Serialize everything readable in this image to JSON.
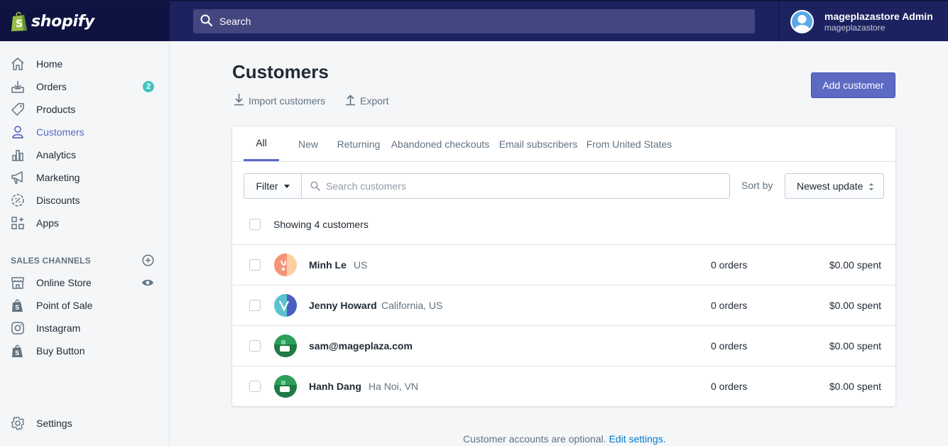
{
  "brand": {
    "logo_text": "shopify",
    "logo_color": "#95bf47"
  },
  "topbar": {
    "search_label": "Search",
    "user_name": "mageplazastore Admin",
    "user_store": "mageplazastore"
  },
  "sidebar": {
    "items": [
      {
        "label": "Home",
        "icon": "home-icon"
      },
      {
        "label": "Orders",
        "icon": "orders-icon",
        "badge": "2"
      },
      {
        "label": "Products",
        "icon": "tag-icon"
      },
      {
        "label": "Customers",
        "icon": "person-icon",
        "active": true
      },
      {
        "label": "Analytics",
        "icon": "bar-chart-icon"
      },
      {
        "label": "Marketing",
        "icon": "megaphone-icon"
      },
      {
        "label": "Discounts",
        "icon": "discount-icon"
      },
      {
        "label": "Apps",
        "icon": "apps-icon"
      }
    ],
    "sales_channels_title": "SALES CHANNELS",
    "channels": [
      {
        "label": "Online Store",
        "icon": "store-icon"
      },
      {
        "label": "Point of Sale",
        "icon": "shopify-bag-icon"
      },
      {
        "label": "Instagram",
        "icon": "instagram-icon"
      },
      {
        "label": "Buy Button",
        "icon": "shopify-bag-icon"
      }
    ],
    "settings_label": "Settings"
  },
  "main": {
    "title": "Customers",
    "import_label": "Import customers",
    "export_label": "Export",
    "add_button": "Add customer",
    "tabs": [
      "All",
      "New",
      "Returning",
      "Abandoned checkouts",
      "Email subscribers",
      "From United States"
    ],
    "filter_label": "Filter",
    "search_placeholder": "Search customers",
    "sort_by_label": "Sort by",
    "sort_value": "Newest update",
    "showing_text": "Showing 4 customers",
    "customers": [
      {
        "name": "Minh Le",
        "location": "US",
        "orders": "0 orders",
        "spent": "$0.00 spent",
        "avatar": "coral"
      },
      {
        "name": "Jenny Howard",
        "location": "California, US",
        "orders": "0 orders",
        "spent": "$0.00 spent",
        "avatar": "teal"
      },
      {
        "name": "sam@mageplaza.com",
        "location": "",
        "orders": "0 orders",
        "spent": "$0.00 spent",
        "avatar": "green"
      },
      {
        "name": "Hanh Dang",
        "location": "Ha Noi, VN",
        "orders": "0 orders",
        "spent": "$0.00 spent",
        "avatar": "green"
      }
    ],
    "footer_text": "Customer accounts are optional.",
    "footer_link": "Edit settings."
  },
  "colors": {
    "accent": "#5c6ac4",
    "topbar": "#1c2260",
    "badge": "#47c1bf",
    "link": "#007ace"
  }
}
